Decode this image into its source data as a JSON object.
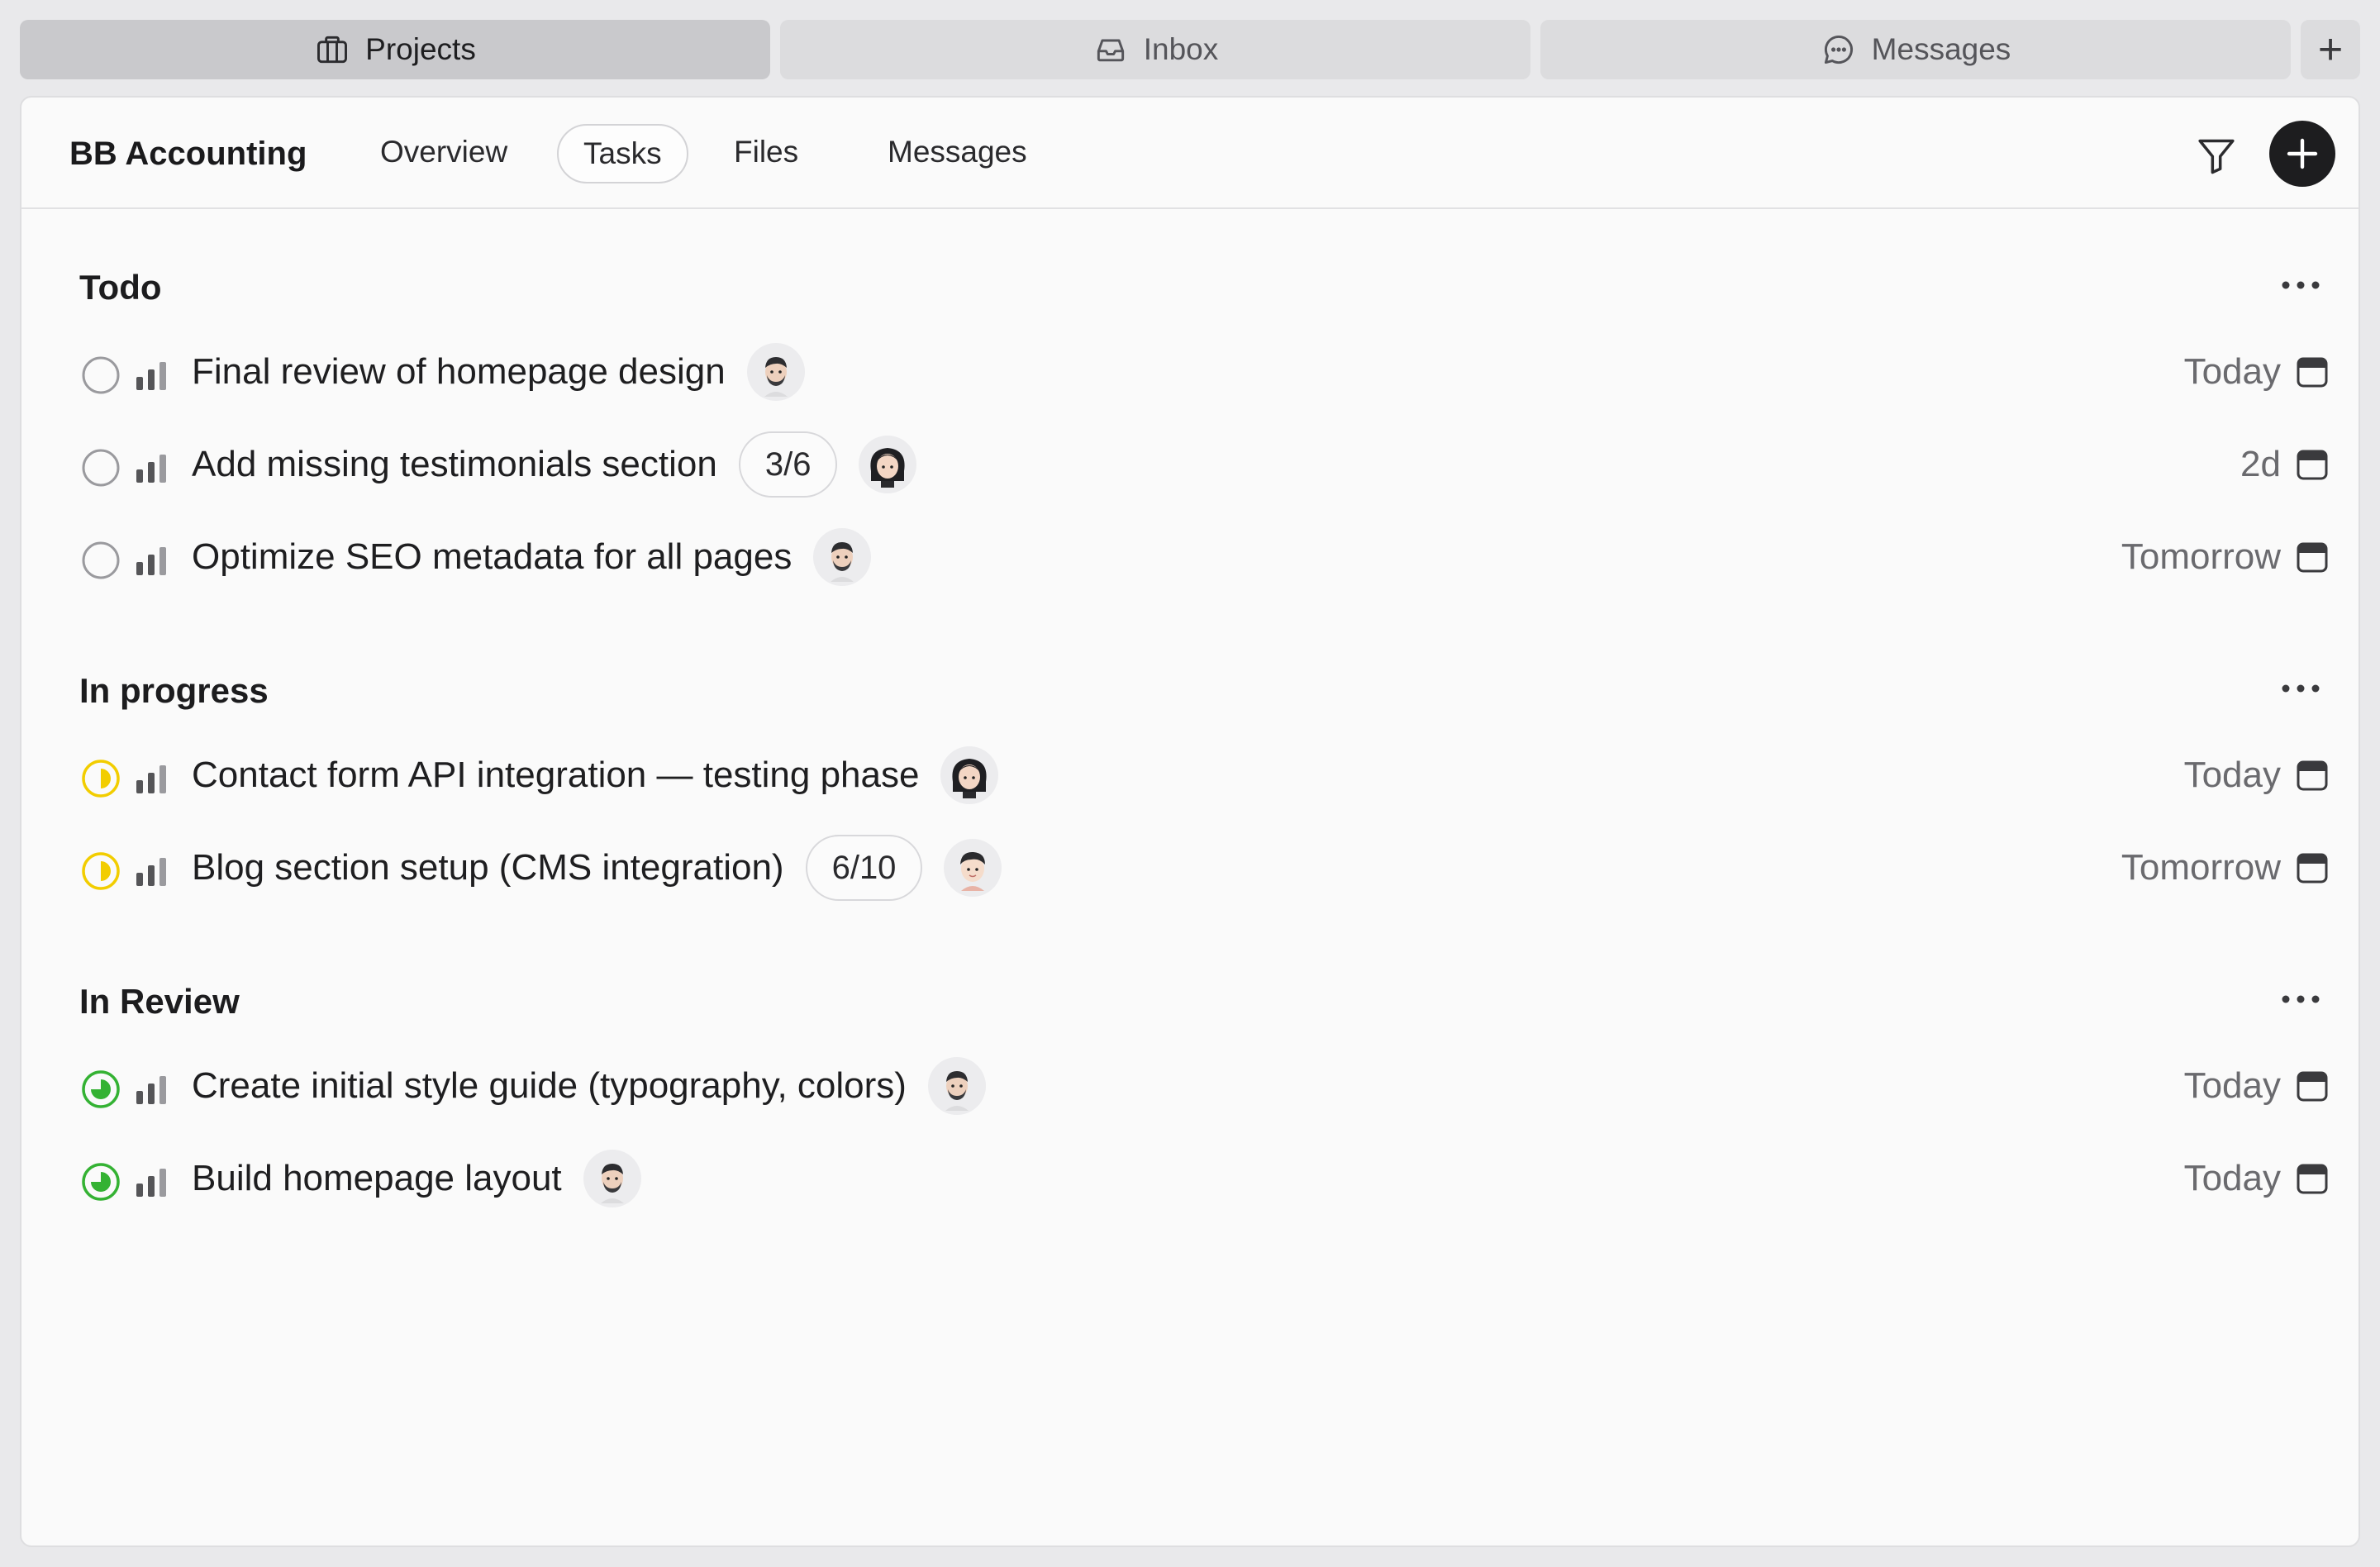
{
  "window_tabs": [
    {
      "label": "Projects",
      "icon": "briefcase-icon",
      "active": true
    },
    {
      "label": "Inbox",
      "icon": "inbox-icon",
      "active": false
    },
    {
      "label": "Messages",
      "icon": "chat-bubble-icon",
      "active": false
    }
  ],
  "window_add_label": "+",
  "header": {
    "project_name": "BB Accounting",
    "tabs": [
      {
        "label": "Overview",
        "active": false
      },
      {
        "label": "Tasks",
        "active": true
      },
      {
        "label": "Files",
        "active": false
      },
      {
        "label": "Messages",
        "active": false
      }
    ]
  },
  "colors": {
    "in_progress": "#f2cd00",
    "in_review": "#34b233",
    "todo": "#9a9a9e",
    "accent_dark": "#1d1d1f"
  },
  "sections": [
    {
      "title": "Todo",
      "status": "todo",
      "tasks": [
        {
          "title": "Final review of homepage design",
          "count": "",
          "assignee": "man-beard-avatar",
          "due": "Today"
        },
        {
          "title": "Add missing testimonials section",
          "count": "3/6",
          "assignee": "woman-dark-hair-avatar",
          "due": "2d"
        },
        {
          "title": "Optimize SEO metadata for all pages",
          "count": "",
          "assignee": "man-beard-avatar",
          "due": "Tomorrow"
        }
      ]
    },
    {
      "title": "In progress",
      "status": "in_progress",
      "tasks": [
        {
          "title": "Contact form API integration — testing phase",
          "count": "",
          "assignee": "woman-dark-hair-avatar",
          "due": "Today"
        },
        {
          "title": "Blog section setup (CMS integration)",
          "count": "6/10",
          "assignee": "boy-avatar",
          "due": "Tomorrow"
        }
      ]
    },
    {
      "title": "In Review",
      "status": "in_review",
      "tasks": [
        {
          "title": "Create initial style guide (typography, colors)",
          "count": "",
          "assignee": "man-beard-avatar",
          "due": "Today"
        },
        {
          "title": "Build homepage layout",
          "count": "",
          "assignee": "man-beard-avatar",
          "due": "Today"
        }
      ]
    }
  ]
}
